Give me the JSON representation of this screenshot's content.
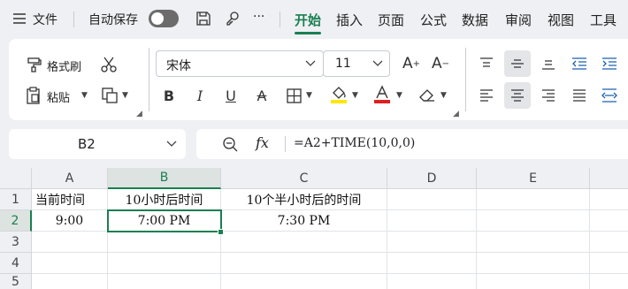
{
  "menu": {
    "file_label": "文件",
    "autosave_label": "自动保存",
    "more_label": "···",
    "tabs": [
      "开始",
      "插入",
      "页面",
      "公式",
      "数据",
      "审阅",
      "视图",
      "工具"
    ]
  },
  "ribbon": {
    "format_painter_label": "格式刷",
    "paste_label": "粘贴",
    "font_name": "宋体",
    "font_size": "11",
    "increase_font_icon": "A⁺",
    "decrease_font_icon": "A⁻",
    "colors": {
      "highlight": "#ffe600",
      "font_color": "#e02020",
      "accent": "#1a7f52"
    }
  },
  "formula_bar": {
    "cell_ref": "B2",
    "fx_label": "fx",
    "formula": "=A2+TIME(10,0,0)"
  },
  "sheet": {
    "columns": [
      "A",
      "B",
      "C",
      "D",
      "E"
    ],
    "rows": [
      "1",
      "2",
      "3",
      "4",
      "5"
    ],
    "cells": {
      "A1": "当前时间",
      "B1": "10小时后时间",
      "C1": "10个半小时后的时间",
      "A2": "9:00",
      "B2": "7:00 PM",
      "C2": "7:30 PM"
    },
    "selected_cell": "B2"
  }
}
